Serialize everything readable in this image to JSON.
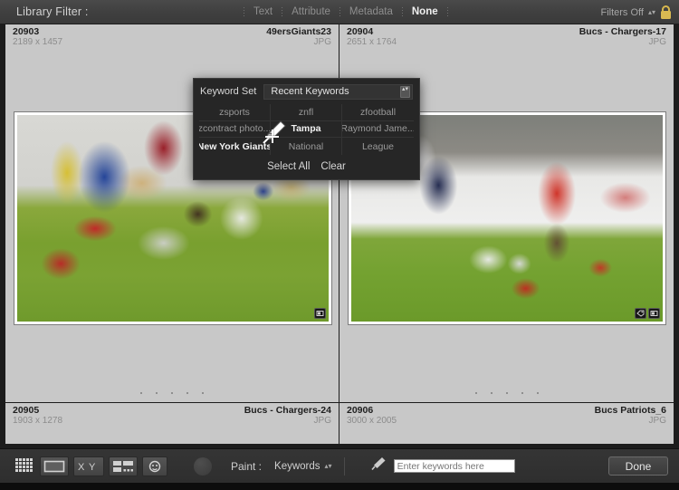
{
  "filter_bar": {
    "title": "Library Filter :",
    "menus": [
      {
        "label": "Text",
        "active": false
      },
      {
        "label": "Attribute",
        "active": false
      },
      {
        "label": "Metadata",
        "active": false
      },
      {
        "label": "None",
        "active": true
      }
    ],
    "filters_state": "Filters Off",
    "stepper_glyph": "▴▾",
    "lock_icon": "open-padlock-icon"
  },
  "grid": {
    "cells": [
      {
        "id": "20903",
        "dimensions": "2189 x 1457",
        "name": "49ersGiants23",
        "format": "JPG"
      },
      {
        "id": "20904",
        "dimensions": "2651 x 1764",
        "name": "Bucs - Chargers-17",
        "format": "JPG"
      },
      {
        "id": "20905",
        "dimensions": "1903 x 1278",
        "name": "Bucs - Chargers-24",
        "format": "JPG"
      },
      {
        "id": "20906",
        "dimensions": "3000 x 2005",
        "name": "Bucs Patriots_6",
        "format": "JPG"
      }
    ],
    "rating_dots": 5
  },
  "keyword_panel": {
    "set_label": "Keyword Set",
    "set_value": "Recent Keywords",
    "stepper_glyph": "▴▾",
    "keywords": [
      {
        "label": "zsports",
        "selected": false
      },
      {
        "label": "znfl",
        "selected": false
      },
      {
        "label": "zfootball",
        "selected": false
      },
      {
        "label": "zcontract photo...",
        "selected": false
      },
      {
        "label": "Tampa",
        "selected": true
      },
      {
        "label": "Raymond Jame...",
        "selected": false
      },
      {
        "label": "New York Giants",
        "selected": true
      },
      {
        "label": "National",
        "selected": false
      },
      {
        "label": "League",
        "selected": false
      }
    ],
    "select_all_label": "Select All",
    "clear_label": "Clear"
  },
  "toolbar": {
    "view_buttons": [
      {
        "name": "grid-view-icon"
      },
      {
        "name": "loupe-view-icon"
      },
      {
        "name": "compare-view-icon"
      },
      {
        "name": "survey-view-icon"
      },
      {
        "name": "people-view-icon"
      }
    ],
    "paint_label": "Paint :",
    "paint_value": "Keywords",
    "paint_stepper_glyph": "▴▾",
    "spray_icon": "spray-can-icon",
    "keyword_input_placeholder": "Enter keywords here",
    "keyword_input_value": "",
    "done_label": "Done"
  },
  "colors": {
    "chrome": "#3f3f3f",
    "cell_bg": "#c8c8c8",
    "panel_bg": "#262626",
    "accent_lock": "#d9ba52",
    "selected_text": "#f2f2f2"
  }
}
